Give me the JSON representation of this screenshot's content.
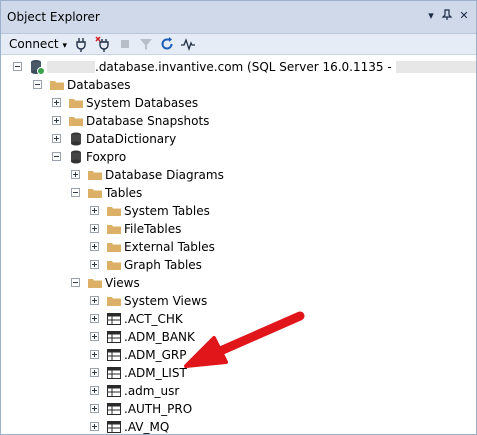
{
  "window": {
    "title": "Object Explorer",
    "pin_icon": "pin-icon",
    "dropdown_icon": "window-position-dropdown-icon",
    "close_icon": "close-icon"
  },
  "toolbar": {
    "connect_label": "Connect",
    "tools": [
      "connect-object-explorer-icon",
      "disconnect-icon",
      "stop-icon",
      "filter-icon",
      "refresh-icon",
      "activity-monitor-icon"
    ]
  },
  "server": {
    "label_suffix": ".database.invantive.com (SQL Server 16.0.1135 - ",
    "label_end": ")"
  },
  "tree": {
    "databases": "Databases",
    "system_databases": "System Databases",
    "database_snapshots": "Database Snapshots",
    "datadictionary": "DataDictionary",
    "foxpro": "Foxpro",
    "database_diagrams": "Database Diagrams",
    "tables": "Tables",
    "system_tables": "System Tables",
    "filetables": "FileTables",
    "external_tables": "External Tables",
    "graph_tables": "Graph Tables",
    "views": "Views",
    "system_views": "System Views",
    "view_items": [
      ".ACT_CHK",
      ".ADM_BANK",
      ".ADM_GRP",
      ".ADM_LIST",
      ".adm_usr",
      ".AUTH_PRO",
      ".AV_MQ"
    ]
  },
  "colors": {
    "titlebar": "#cfd9ea",
    "toolbar": "#e6ecf6",
    "folder": "#dcb167",
    "annotation_arrow": "#e0161b"
  }
}
